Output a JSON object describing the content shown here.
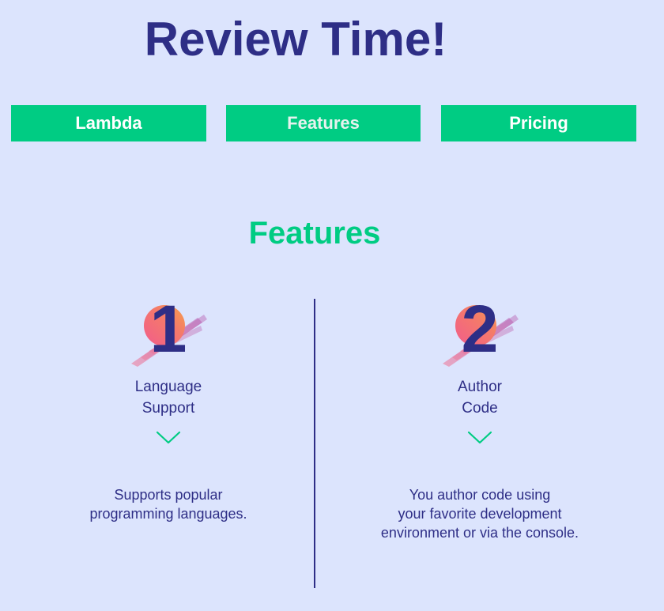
{
  "header": {
    "title": "Review Time!"
  },
  "nav": {
    "tabs": [
      {
        "label": "Lambda"
      },
      {
        "label": "Features"
      },
      {
        "label": "Pricing"
      }
    ]
  },
  "section": {
    "title": "Features"
  },
  "features": [
    {
      "number": "1",
      "name_lines": [
        "Language",
        "Support"
      ],
      "description_lines": [
        "Supports popular",
        "programming languages."
      ]
    },
    {
      "number": "2",
      "name_lines": [
        "Author",
        "Code"
      ],
      "description_lines": [
        "You author code using",
        "your favorite development",
        "environment or via the console."
      ]
    }
  ],
  "colors": {
    "background": "#dce4fd",
    "primary": "#2e2e86",
    "accent": "#00cc83"
  },
  "icons": {
    "expand": "chevron-down-icon",
    "badge_art": "brush-stroke-icon"
  }
}
